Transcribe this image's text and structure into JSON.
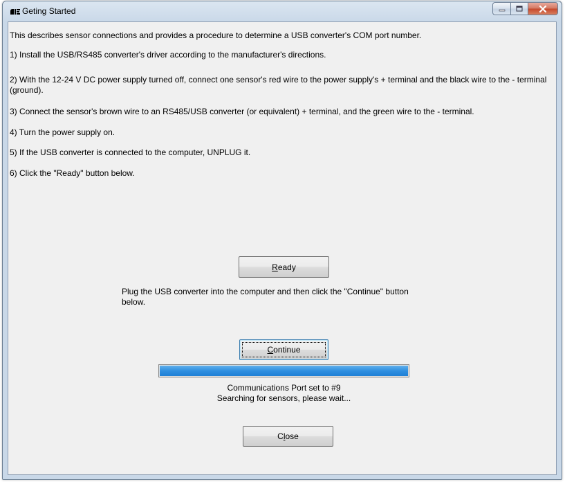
{
  "window": {
    "title": "Geting Started"
  },
  "intro": {
    "line0": "This describes sensor connections and provides a procedure to determine a USB converter's COM port number.",
    "line1": "1) Install the USB/RS485 converter's driver according to the manufacturer's directions.",
    "line2": "2) With the 12-24 V DC power supply turned off, connect one sensor's red wire to the power supply's + terminal and the black wire to the - terminal (ground).",
    "line3": "3) Connect the sensor's brown wire to an RS485/USB converter (or equivalent) + terminal, and the green wire to the - terminal.",
    "line4": "4) Turn the power supply on.",
    "line5": "5) If the USB converter is connected to the computer, UNPLUG it.",
    "line6": "6) Click the \"Ready\" button below."
  },
  "buttons": {
    "ready_accel": "R",
    "ready_rest": "eady",
    "continue_accel": "C",
    "continue_rest": "ontinue",
    "close_pre": "C",
    "close_accel": "l",
    "close_rest": "ose"
  },
  "plug_instruction": "Plug the USB converter into the computer and then click the \"Continue\" button below.",
  "progress": {
    "value": 1.0,
    "color": "#2f8fe0"
  },
  "status": {
    "port": "Communications Port set to #9",
    "searching": "Searching for sensors, please wait..."
  },
  "icons": {
    "app": "app-logo-icon",
    "minimize": "minimize-icon",
    "maximize": "maximize-icon",
    "close": "close-icon"
  }
}
